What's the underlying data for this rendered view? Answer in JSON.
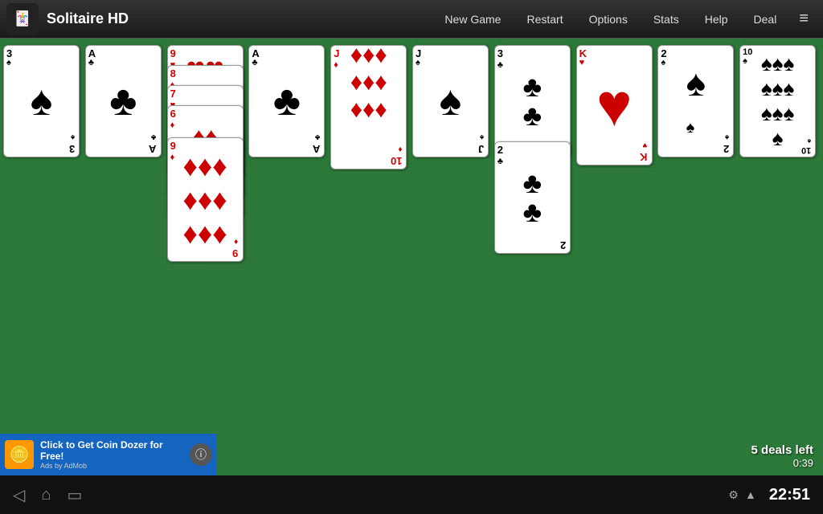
{
  "app": {
    "icon": "🃏",
    "title": "Solitaire HD"
  },
  "nav": {
    "new_game": "New Game",
    "restart": "Restart",
    "options": "Options",
    "stats": "Stats",
    "help": "Help",
    "deal": "Deal",
    "menu_icon": "≡"
  },
  "game": {
    "deals_left": "5 deals left",
    "timer": "0:39"
  },
  "ad": {
    "title": "Click to Get Coin Dozer for Free!",
    "sub": "Ads by AdMob"
  },
  "system": {
    "time": "22:51"
  }
}
